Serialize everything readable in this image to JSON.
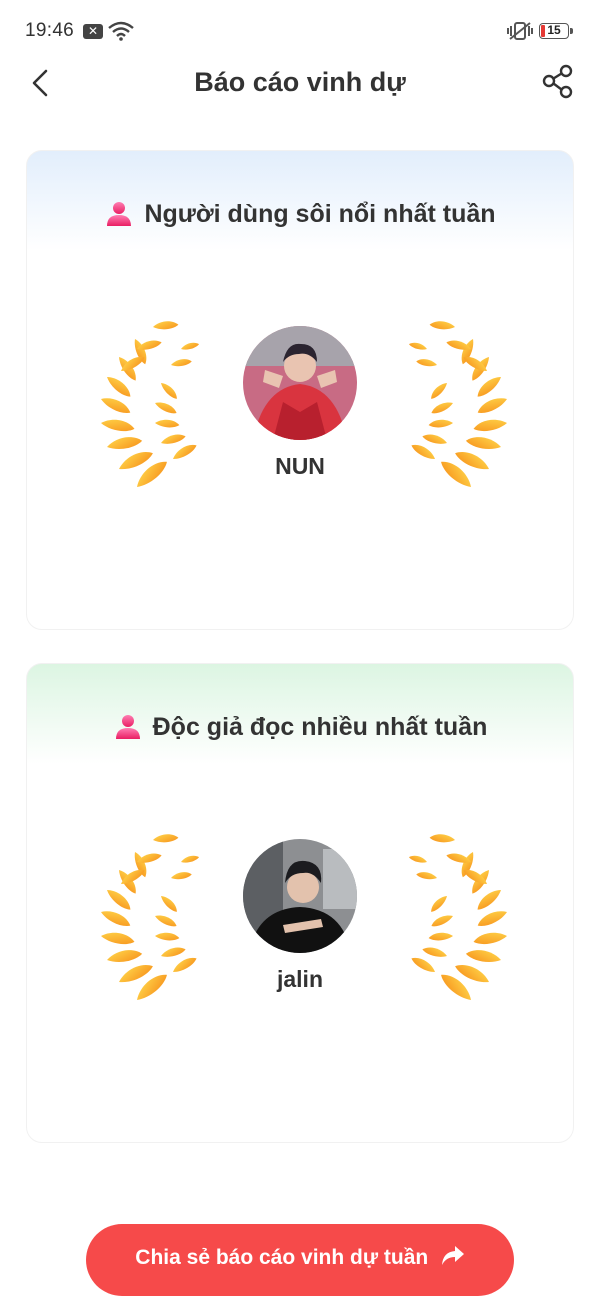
{
  "status_bar": {
    "time": "19:46",
    "notification_badge": "✕",
    "battery_level": "15",
    "battery_color": "#e53935"
  },
  "header": {
    "title": "Báo cáo vinh dự",
    "back_icon": "chevron-left-icon",
    "share_icon": "share-nodes-icon"
  },
  "cards": [
    {
      "title": "Người dùng sôi nổi nhất tuần",
      "icon": "user-icon",
      "user": "NUN",
      "accent": "#e2eefc"
    },
    {
      "title": "Độc giả đọc nhiều nhất tuần",
      "icon": "user-icon",
      "user": "jalin",
      "accent": "#dcf5e2"
    }
  ],
  "share_button": {
    "label": "Chia sẻ báo cáo vinh dự tuần",
    "color": "#f64a4a",
    "icon": "share-arrow-icon"
  }
}
